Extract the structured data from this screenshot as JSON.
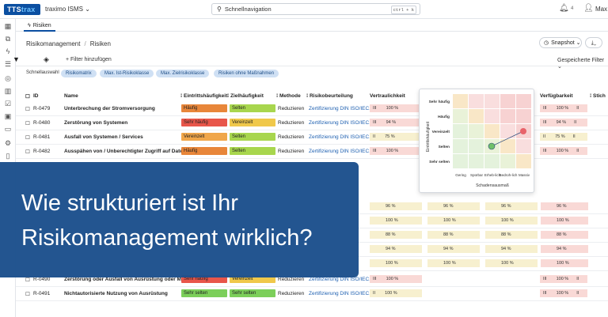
{
  "app": {
    "logo_a": "TTS",
    "logo_b": "trax",
    "org": "traximo ISMS ⌄",
    "search_placeholder": "Schnellnavigation",
    "shortcut": "ctrl + k",
    "notifications": "4",
    "user": "Max"
  },
  "tab": {
    "label": "Risiken"
  },
  "breadcrumb": {
    "parent": "Risikomanagement",
    "sep": "/",
    "current": "Risiken"
  },
  "actions": {
    "snapshot": "Snapshot ⌄",
    "download": "⌄"
  },
  "toolbar": {
    "add_filter": "+ Filter hinzufügen",
    "saved_filters": "Gespeicherte Filter ⌄"
  },
  "quick": {
    "label": "Schnellauswahl",
    "pills": [
      "Risikomatrix",
      "Max. Ist-Risikoklasse",
      "Max. Zielrisikoklasse",
      "Risiken ohne Maßnahmen"
    ]
  },
  "columns": {
    "id": "ID",
    "name": "Name",
    "eintritt": "Eintrittshäufigkeit",
    "ziel": "Zielhäufigkeit",
    "methode": "Methode",
    "beurteilung": "Risikobeurteilung",
    "vertraulich": "Vertraulichkeit",
    "verfuegbar": "Verfügbarkeit",
    "stich": "Stich"
  },
  "rows": [
    {
      "id": "R-0479",
      "name": "Unterbrechung der Stromversorgung",
      "eintritt": "Häufig",
      "ziel": "Selten",
      "methode": "Reduzieren",
      "beurteilung": "Zertifizierung DIN ISO/IEC...",
      "v_pre": "III",
      "v": "100 %",
      "verf": "100 %",
      "verf_pre": "III",
      "verf_post": "II",
      "ec": "#e8863a",
      "zc": "#a8d64e",
      "vc": "#f9d9d6",
      "fc": "#f9d9d6"
    },
    {
      "id": "R-0480",
      "name": "Zerstörung von Systemen",
      "eintritt": "Sehr häufig",
      "ziel": "Vereinzelt",
      "methode": "Reduzieren",
      "beurteilung": "Zertifizierung DIN ISO/IEC...",
      "v_pre": "III",
      "v": "94 %",
      "verf": "94 %",
      "verf_pre": "III",
      "verf_post": "II",
      "ec": "#e8564a",
      "zc": "#f0c84a",
      "vc": "#f9d9d6",
      "fc": "#f9d9d6"
    },
    {
      "id": "R-0481",
      "name": "Ausfall von Systemen / Services",
      "eintritt": "Vereinzelt",
      "ziel": "Selten",
      "methode": "Reduzieren",
      "beurteilung": "Zertifizierung DIN ISO/IEC...",
      "v_pre": "II",
      "v": "75 %",
      "verf": "75 %",
      "verf_pre": "II",
      "verf_post": "II",
      "ec": "#f0a64a",
      "zc": "#a8d64e",
      "vc": "#f7f0cf",
      "fc": "#f7f0cf"
    },
    {
      "id": "R-0482",
      "name": "Ausspähen von / Unberechtigter Zugriff auf Daten",
      "eintritt": "Häufig",
      "ziel": "Selten",
      "methode": "Reduzieren",
      "beurteilung": "Zertifizierung DIN ISO/IEC...",
      "v_pre": "III",
      "v": "100 %",
      "verf": "100 %",
      "verf_pre": "III",
      "verf_post": "II",
      "ec": "#e8863a",
      "zc": "#a8d64e",
      "vc": "#f9d9d6",
      "fc": "#f9d9d6"
    },
    {
      "id": "R-0490",
      "name": "Zerstörung oder Ausfall von Ausrüstung oder Me...",
      "eintritt": "Sehr häufig",
      "ziel": "Vereinzelt",
      "methode": "Reduzieren",
      "beurteilung": "Zertifizierung DIN ISO/IEC...",
      "v_pre": "III",
      "v": "100 %",
      "verf": "100 %",
      "verf_pre": "III",
      "verf_post": "II",
      "ec": "#e8564a",
      "zc": "#f0c84a",
      "vc": "#f9d9d6",
      "fc": "#f9d9d6"
    },
    {
      "id": "R-0491",
      "name": "Nichtautorisierte Nutzung von Ausrüstung",
      "eintritt": "Sehr selten",
      "ziel": "Sehr selten",
      "methode": "Reduzieren",
      "beurteilung": "Zertifizierung DIN ISO/IEC...",
      "v_pre": "II",
      "v": "100 %",
      "verf": "100 %",
      "verf_pre": "III",
      "verf_post": "II",
      "ec": "#7ccf5a",
      "zc": "#7ccf5a",
      "vc": "#f7f0cf",
      "fc": "#f9d9d6"
    }
  ],
  "hidden_rows": [
    {
      "v": "96 %",
      "m": "96 %",
      "r": "96 %"
    },
    {
      "v": "100 %",
      "m": "100 %",
      "r": "100 %"
    },
    {
      "v": "88 %",
      "m": "88 %",
      "r": "88 %"
    },
    {
      "v": "94 %",
      "m": "94 %",
      "r": "94 %"
    },
    {
      "v": "100 %",
      "m": "100 %",
      "r": "100 %"
    }
  ],
  "matrix": {
    "y_axis": "Eintrittshäufigkeit",
    "x_axis": "Schadensausmaß",
    "rows": [
      "Sehr häufig",
      "Häufig",
      "Vereinzelt",
      "Selten",
      "Sehr selten"
    ],
    "cols": [
      "Gering",
      "Spürbar",
      "Erheb-lich",
      "Bedroh-lich",
      "Massiv"
    ]
  },
  "overlay": {
    "line1": "Wie strukturiert ist Ihr",
    "line2": "Risikomanagement wirklich?"
  }
}
